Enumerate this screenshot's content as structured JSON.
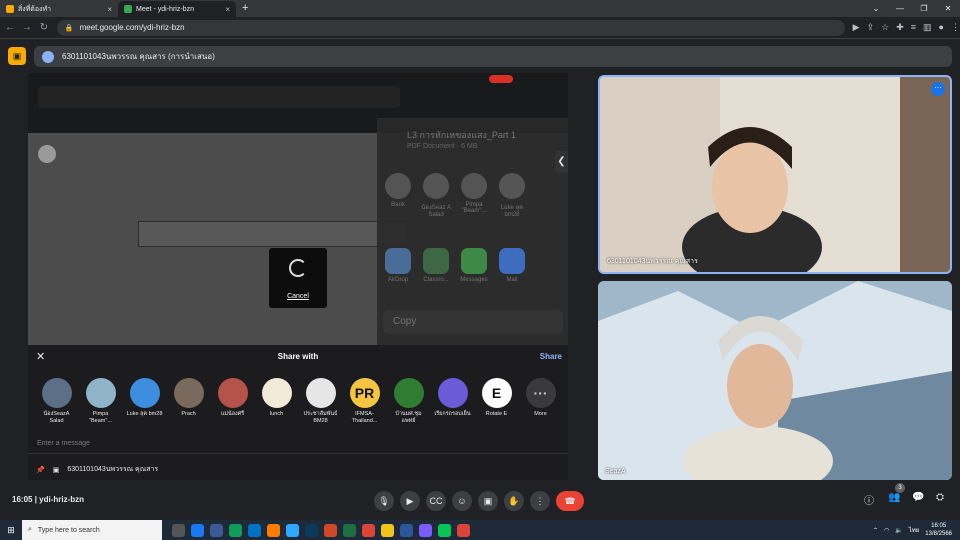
{
  "browser": {
    "tabs": [
      {
        "label": "สิ่งที่ต้องทำ",
        "active": false,
        "favicon_color": "#f9ab00"
      },
      {
        "label": "Meet - ydi-hriz-bzn",
        "active": true,
        "favicon_color": "#34a853"
      }
    ],
    "new_tab": "+",
    "url": "meet.google.com/ydi-hriz-bzn"
  },
  "presenter": {
    "name": "6301101043นพวรรณ คุณสาร (การนำเสนอ)"
  },
  "presentation": {
    "sheet_title": "L3 การหักเหของแสง_Part 1",
    "sheet_subtitle": "PDF Document · 6 MB",
    "sheet_people": [
      "Bank",
      "น้องSeaz A Salad",
      "Pimpa \"Beam\"...",
      "Luke ลุค bm28"
    ],
    "sheet_apps": [
      "AirDrop",
      "Classro...",
      "Messages",
      "Mail"
    ],
    "sheet_copy": "Copy",
    "loading_cancel": "Cancel"
  },
  "share_sheet": {
    "title": "Share with",
    "share_label": "Share",
    "contacts": [
      {
        "name": "น้องSeazA Salad",
        "color": "#5c6f86",
        "glyph": ""
      },
      {
        "name": "Pimpa \"Beam\"...",
        "color": "#8fb3c9",
        "glyph": ""
      },
      {
        "name": "Luke ลุค bm28",
        "color": "#3e8ee0",
        "glyph": ""
      },
      {
        "name": "Prach",
        "color": "#7a6a5d",
        "glyph": ""
      },
      {
        "name": "แม่น้องศรี",
        "color": "#b5524a",
        "glyph": ""
      },
      {
        "name": "lunch",
        "color": "#f2ead8",
        "glyph": ""
      },
      {
        "name": "ประชาสัมพันธ์ BM28",
        "color": "#e6e6e6",
        "glyph": ""
      },
      {
        "name": "IFMSA-Thailand...",
        "color": "#f5c542",
        "glyph": "PR"
      },
      {
        "name": "บ้านมศ.ชุมแพทย์",
        "color": "#2e7d32",
        "glyph": ""
      },
      {
        "name": "เรียกรถรอบเย็น",
        "color": "#6b5bd6",
        "glyph": ""
      },
      {
        "name": "Rotate E",
        "color": "#ffffff",
        "glyph": "E"
      },
      {
        "name": "More",
        "color": "#3a3a3c",
        "glyph": "···"
      }
    ],
    "message_placeholder": "Enter a message",
    "footer_name": "6301101043นพวรรณ คุณสาร"
  },
  "tiles": [
    {
      "name": "6301101043นพวรรณ คุณสาร",
      "active_speaker": true
    },
    {
      "name": "SeazA"
    }
  ],
  "controls": {
    "time": "16:05",
    "meeting_code": "ydi-hriz-bzn",
    "participants_count": "3",
    "end_call_color": "#ea4335"
  },
  "taskbar": {
    "search_placeholder": "Type here to search",
    "time": "16:05",
    "date": "13/8/2566",
    "language": "ไทย"
  }
}
